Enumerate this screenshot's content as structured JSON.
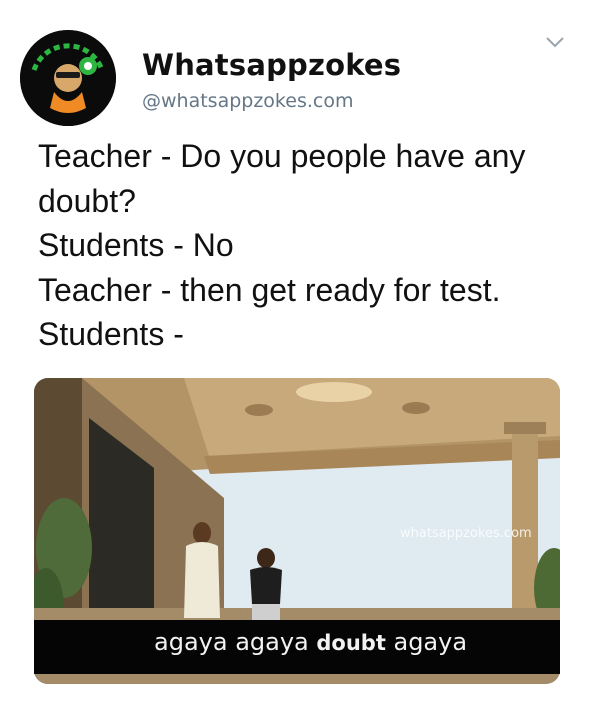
{
  "tweet": {
    "display_name": "Whatsappzokes",
    "handle": "@whatsappzokes.com",
    "avatar_icon": "whatsapp-zokes-logo-icon",
    "menu_icon": "chevron-down-icon",
    "lines": [
      "Teacher - Do you people have any",
      "doubt?",
      "Students - No",
      "Teacher - then get ready for test.",
      "Students -"
    ]
  },
  "media": {
    "watermark": "whatsappzokes.com",
    "subtitle_part1": "agaya agaya ",
    "subtitle_bold": "doubt",
    "subtitle_part2": " agaya"
  },
  "colors": {
    "handle": "#657786",
    "logo_green": "#2db742",
    "subtitle_bg": "#050505"
  }
}
